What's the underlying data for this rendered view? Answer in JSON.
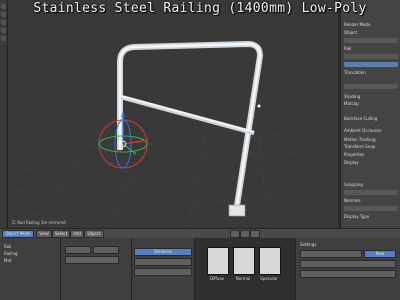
{
  "title": "Stainless Steel Railing (1400mm) Low-Poly",
  "viewport": {
    "info_text": "Z: Rail Railing 1m mirrored"
  },
  "right_panel": {
    "items": [
      "Render Mode",
      "Object",
      "Rail",
      "Translation",
      "Shading",
      "Matcap",
      "Backface Culling",
      "Ambient Occlusion",
      "Motion Tracking",
      "Transform Snap",
      "Properties",
      "Display",
      "Snapping",
      "Normals",
      "Display Type"
    ]
  },
  "bottom_header": {
    "mode_label": "Object Mode",
    "view_label": "View",
    "select_label": "Select",
    "add_label": "Add",
    "object_label": "Object"
  },
  "bottom_area": {
    "left_list": [
      "Rail",
      "Railing",
      "Mat"
    ],
    "material_label": "Stainless",
    "texture_thumbs": [
      "Diffuse",
      "Normal",
      "Specular"
    ],
    "properties_label": "Settings",
    "new_button": "New"
  },
  "colors": {
    "viewport_bg": "#393939",
    "panel_bg": "#444444",
    "accent_blue": "#5680c2",
    "rail_white": "#e8eef3",
    "axis_red": "#d9353a",
    "axis_green": "#3cb34a",
    "axis_blue": "#3a72d6"
  }
}
